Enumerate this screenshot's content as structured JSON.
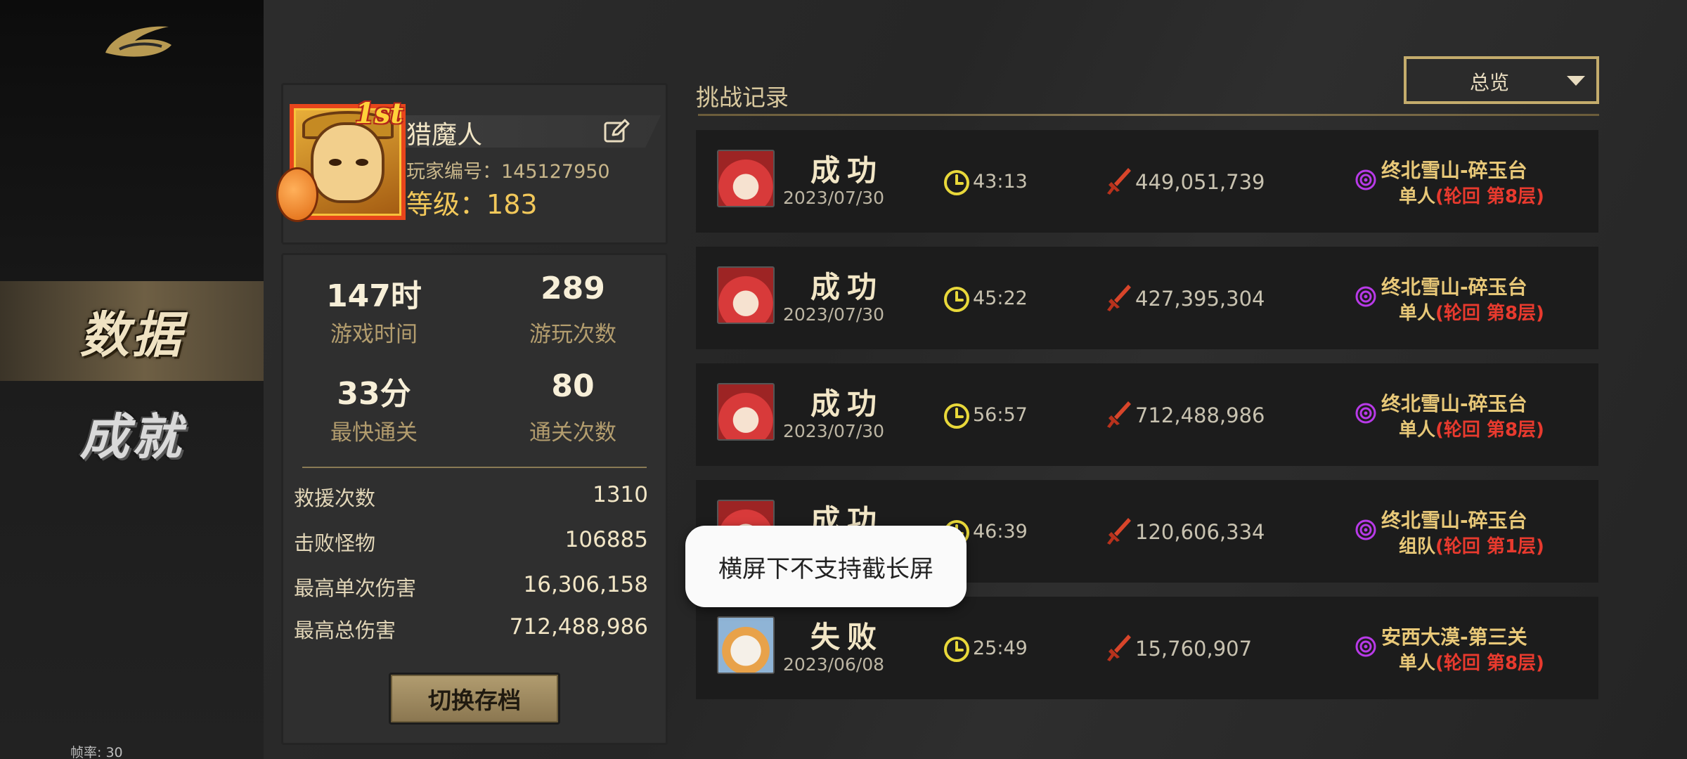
{
  "sidebar": {
    "nav": [
      {
        "label": "数据",
        "active": true
      },
      {
        "label": "成就",
        "active": false
      }
    ],
    "fps": "帧率: 30"
  },
  "profile": {
    "name": "猎魔人",
    "rank_badge": "1st",
    "id_label": "玩家编号：",
    "id_value": "145127950",
    "level_label": "等级：",
    "level_value": "183"
  },
  "stats": {
    "grid": [
      {
        "value": "147时",
        "label": "游戏时间"
      },
      {
        "value": "289",
        "label": "游玩次数"
      },
      {
        "value": "33分",
        "label": "最快通关"
      },
      {
        "value": "80",
        "label": "通关次数"
      }
    ],
    "rows": [
      {
        "label": "救援次数",
        "value": "1310"
      },
      {
        "label": "击败怪物",
        "value": "106885"
      },
      {
        "label": "最高单次伤害",
        "value": "16,306,158"
      },
      {
        "label": "最高总伤害",
        "value": "712,488,986"
      }
    ],
    "switch_label": "切换存档"
  },
  "records": {
    "title": "挑战记录",
    "filter": "总览",
    "items": [
      {
        "result": "成功",
        "date": "2023/07/30",
        "time": "43:13",
        "damage": "449,051,739",
        "stage": "终北雪山-碎玉台",
        "mode": "单人",
        "cycle": "(轮回  第8层)",
        "avatar": "red"
      },
      {
        "result": "成功",
        "date": "2023/07/30",
        "time": "45:22",
        "damage": "427,395,304",
        "stage": "终北雪山-碎玉台",
        "mode": "单人",
        "cycle": "(轮回  第8层)",
        "avatar": "red"
      },
      {
        "result": "成功",
        "date": "2023/07/30",
        "time": "56:57",
        "damage": "712,488,986",
        "stage": "终北雪山-碎玉台",
        "mode": "单人",
        "cycle": "(轮回  第8层)",
        "avatar": "red"
      },
      {
        "result": "成功",
        "date": "",
        "time": "46:39",
        "damage": "120,606,334",
        "stage": "终北雪山-碎玉台",
        "mode": "组队",
        "cycle": "(轮回  第1层)",
        "avatar": "red"
      },
      {
        "result": "失败",
        "date": "2023/06/08",
        "time": "25:49",
        "damage": "15,760,907",
        "stage": "安西大漠-第三关",
        "mode": "单人",
        "cycle": "(轮回  第8层)",
        "avatar": "white"
      }
    ]
  },
  "toast": "横屏下不支持截长屏",
  "colors": {
    "gold": "#c4ac6c",
    "red": "#e83a2e",
    "stage": "#e8c878"
  }
}
